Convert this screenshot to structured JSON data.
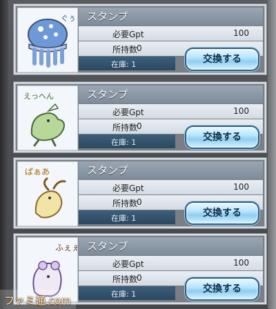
{
  "ui": {
    "cards": [
      {
        "title": "スタンプ",
        "gpt_label": "必要Gpt",
        "gpt_value": "100",
        "owned_label": "所持数",
        "owned_value": "0",
        "stock_label": "在庫: 1",
        "button_label": "交換する",
        "sticker_text": "ぐぅ"
      },
      {
        "title": "スタンプ",
        "gpt_label": "必要Gpt",
        "gpt_value": "100",
        "owned_label": "所持数",
        "owned_value": "0",
        "stock_label": "在庫: 1",
        "button_label": "交換する",
        "sticker_text": "えっへん"
      },
      {
        "title": "スタンプ",
        "gpt_label": "必要Gpt",
        "gpt_value": "100",
        "owned_label": "所持数",
        "owned_value": "0",
        "stock_label": "在庫: 1",
        "button_label": "交換する",
        "sticker_text": "ぱぁあ"
      },
      {
        "title": "スタンプ",
        "gpt_label": "必要Gpt",
        "gpt_value": "100",
        "owned_label": "所持数",
        "owned_value": "0",
        "stock_label": "在庫: 1",
        "button_label": "交換する",
        "sticker_text": "ふぇぇ"
      }
    ]
  },
  "watermark": "ファミ通.com",
  "colors": {
    "accent": "#8fcdf0",
    "title_bar": "#7e8b99",
    "stock_row": "#2b4860"
  }
}
